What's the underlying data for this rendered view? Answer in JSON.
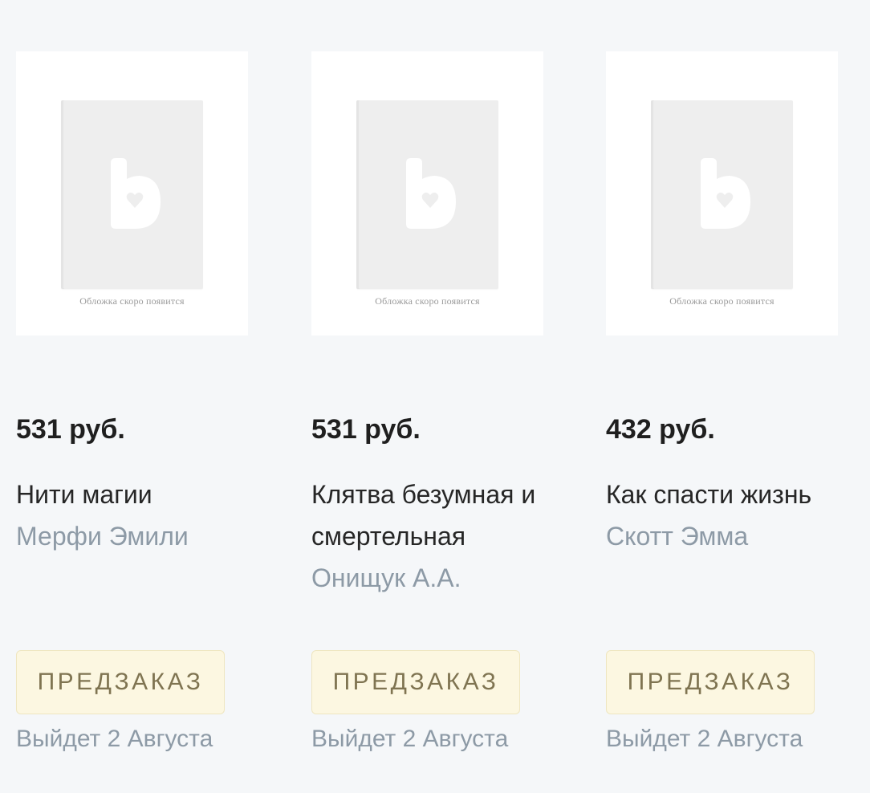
{
  "colors": {
    "background": "#f5f7f9",
    "price_text": "#1f1f1f",
    "author_text": "#8d9aa6",
    "button_bg": "#fcf7e1",
    "button_text": "#7f7451"
  },
  "products": [
    {
      "cover_caption": "Обложка скоро появится",
      "cover_icon": "publisher-logo-icon",
      "price": "531 руб.",
      "title": "Нити магии",
      "author": "Мерфи Эмили",
      "button_label": "ПРЕДЗАКАЗ",
      "release": "Выйдет 2 Августа"
    },
    {
      "cover_caption": "Обложка скоро появится",
      "cover_icon": "publisher-logo-icon",
      "price": "531 руб.",
      "title": "Клятва безумная и смертельная",
      "author": "Онищук А.А.",
      "button_label": "ПРЕДЗАКАЗ",
      "release": "Выйдет 2 Августа"
    },
    {
      "cover_caption": "Обложка скоро появится",
      "cover_icon": "publisher-logo-icon",
      "price": "432 руб.",
      "title": "Как спасти жизнь",
      "author": "Скотт Эмма",
      "button_label": "ПРЕДЗАКАЗ",
      "release": "Выйдет 2 Августа"
    }
  ]
}
